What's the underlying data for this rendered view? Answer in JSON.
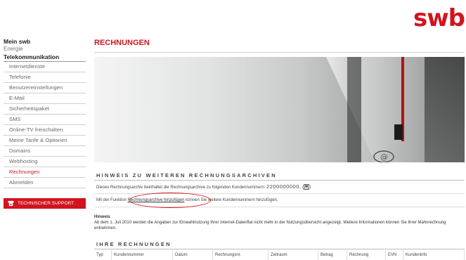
{
  "brand": {
    "logo": "swb"
  },
  "sidebar": {
    "head_main": "Mein swb",
    "head_energy": "Energie",
    "head_tele": "Telekommunikation",
    "items": [
      {
        "label": "Internetdienste",
        "active": false
      },
      {
        "label": "Telefonie",
        "active": false
      },
      {
        "label": "Benutzereinstellungen",
        "active": false
      },
      {
        "label": "E-Mail",
        "active": false
      },
      {
        "label": "Sicherheitspaket",
        "active": false
      },
      {
        "label": "SMS",
        "active": false
      },
      {
        "label": "Online-TV freischalten",
        "active": false
      },
      {
        "label": "Meine Tarife & Optionen",
        "active": false
      },
      {
        "label": "Domains",
        "active": false
      },
      {
        "label": "Webhosting",
        "active": false
      },
      {
        "label": "Rechnungen",
        "active": true
      },
      {
        "label": "Abmelden",
        "active": false
      }
    ],
    "support_label": "TECHNISCHER SUPPORT"
  },
  "main": {
    "title": "RECHNUNGEN",
    "archive": {
      "heading": "HINWEIS ZU WEITEREN RECHNUNGSARCHIVEN",
      "line1_text": "Dieses Rechnungsarchiv beinhaltet die Rechnungsarchive zu folgenden Kundennummern:",
      "customer_number": "2200000000,",
      "line2_before": "Mit der Funktion",
      "line2_link": "Rechnungsarchive hinzufügen",
      "line2_after": "können Sie weitere Kundennummern hinzufügen."
    },
    "hint": {
      "title": "Hinweis",
      "text": "Ab dem 1. Juli 2010 werden die Angaben zur Einwahlnutzung Ihrer Internet-Datenflat nicht mehr in der Nutzungsübersicht angezeigt. Weitere Informationen können Sie Ihrer Mahnrechnung entnehmen."
    },
    "invoices": {
      "heading": "IHRE RECHNUNGEN",
      "columns": [
        "Typ",
        "Kundennummer",
        "Datum",
        "Rechnungsnr.",
        "Zeitraum",
        "Betrag",
        "Rechnung",
        "EVN",
        "Kundeninfo"
      ]
    }
  },
  "colors": {
    "accent": "#d2141e",
    "text": "#333333"
  }
}
